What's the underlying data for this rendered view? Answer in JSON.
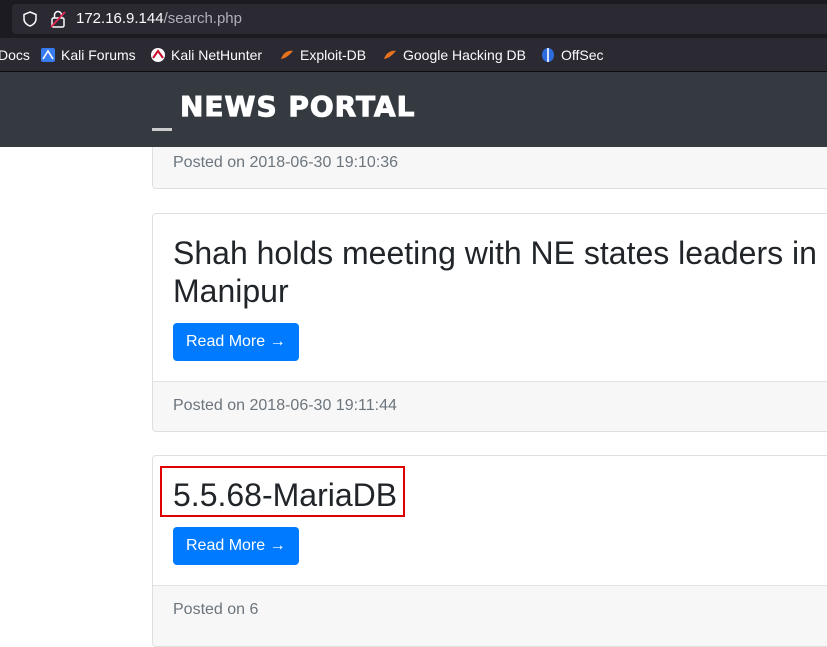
{
  "browser": {
    "url_host": "172.16.9.144",
    "url_path": "/search.php",
    "bookmarks": [
      {
        "label": "Docs",
        "icon": "docs-icon"
      },
      {
        "label": "Kali Forums",
        "icon": "kali-forums-icon"
      },
      {
        "label": "Kali NetHunter",
        "icon": "kali-nethunter-icon"
      },
      {
        "label": "Exploit-DB",
        "icon": "exploit-db-icon"
      },
      {
        "label": "Google Hacking DB",
        "icon": "google-hacking-db-icon"
      },
      {
        "label": "OffSec",
        "icon": "offsec-icon"
      }
    ]
  },
  "site": {
    "brand": "NEWS PORTAL"
  },
  "posts": [
    {
      "posted": "Posted on 2018-06-30 19:10:36"
    },
    {
      "title": "Shah holds meeting with NE states leaders in Manipur",
      "button": "Read More →",
      "posted": "Posted on 2018-06-30 19:11:44"
    },
    {
      "title": "5.5.68-MariaDB",
      "button": "Read More →",
      "posted": "Posted on 6"
    }
  ],
  "colors": {
    "navbar": "#343a40",
    "button": "#007bff",
    "highlight": "#e00000"
  }
}
